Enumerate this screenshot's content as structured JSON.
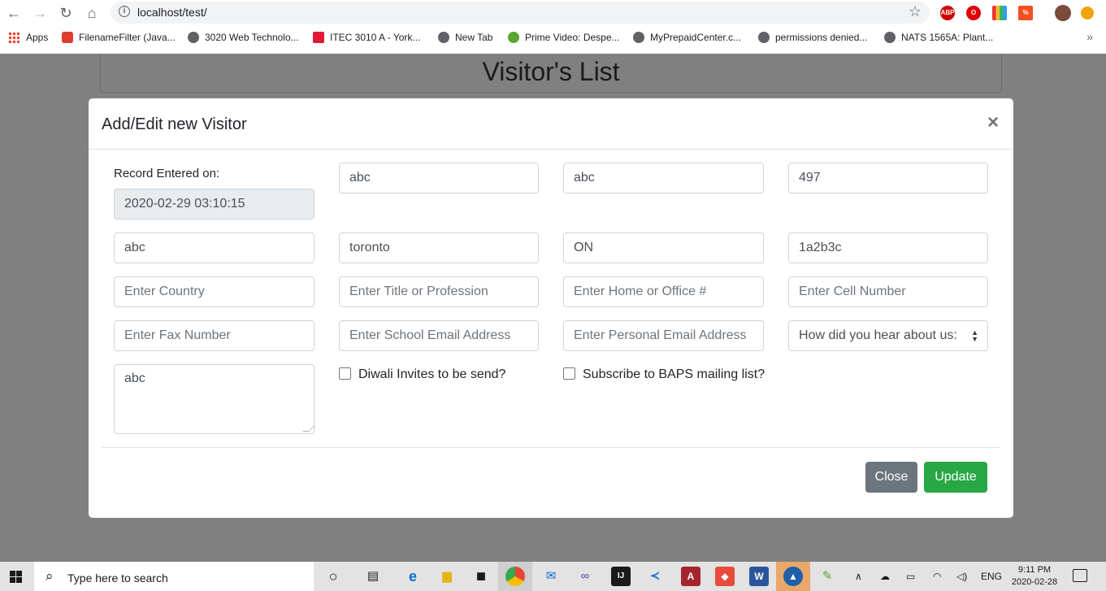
{
  "browser": {
    "url": "localhost/test/",
    "nav": {
      "back": "←",
      "forward": "→",
      "reload": "↻",
      "home": "⌂"
    },
    "bookmarks": [
      {
        "label": "Apps",
        "icon": "apps-grid-icon"
      },
      {
        "label": "FilenameFilter (Java...",
        "icon": "oracle-icon",
        "color": "#e03c31"
      },
      {
        "label": "3020 Web Technolo...",
        "icon": "globe-icon",
        "color": "#5f6368"
      },
      {
        "label": "ITEC 3010 A - York...",
        "icon": "york-icon",
        "color": "#e31837"
      },
      {
        "label": "New Tab",
        "icon": "globe-icon",
        "color": "#5f6368"
      },
      {
        "label": "Prime Video: Despe...",
        "icon": "prime-icon",
        "color": "#5aa62f"
      },
      {
        "label": "MyPrepaidCenter.c...",
        "icon": "globe-icon",
        "color": "#5f6368"
      },
      {
        "label": "permissions denied...",
        "icon": "globe-icon",
        "color": "#5f6368"
      },
      {
        "label": "NATS 1565A: Plant...",
        "icon": "globe-icon",
        "color": "#5f6368"
      }
    ],
    "more": "»"
  },
  "page": {
    "title": "Visitor's List"
  },
  "modal": {
    "title": "Add/Edit new Visitor",
    "close_symbol": "×",
    "record_label": "Record Entered on:",
    "record_value": "2020-02-29 03:10:15",
    "row1": {
      "field2": "abc",
      "field3": "abc",
      "field4": "497"
    },
    "row2": {
      "field1": "abc",
      "field2": "toronto",
      "field3": "ON",
      "field4": "1a2b3c"
    },
    "row3": {
      "country_placeholder": "Enter Country",
      "title_placeholder": "Enter Title or Profession",
      "home_placeholder": "Enter Home or Office #",
      "cell_placeholder": "Enter Cell Number"
    },
    "row4": {
      "fax_placeholder": "Enter Fax Number",
      "school_email_placeholder": "Enter School Email Address",
      "personal_email_placeholder": "Enter Personal Email Address",
      "hear_about_selected": "How did you hear about us:"
    },
    "notes_value": "abc",
    "diwali_label": "Diwali Invites to be send?",
    "baps_label": "Subscribe to BAPS mailing list?",
    "close_button": "Close",
    "update_button": "Update"
  },
  "taskbar": {
    "search_text": "Type here to search",
    "lang": "ENG",
    "time": "9:11 PM",
    "date": "2020-02-28"
  },
  "colors": {
    "primary_green": "#28a745",
    "secondary_gray": "#6c757d",
    "backdrop": "#808080"
  }
}
